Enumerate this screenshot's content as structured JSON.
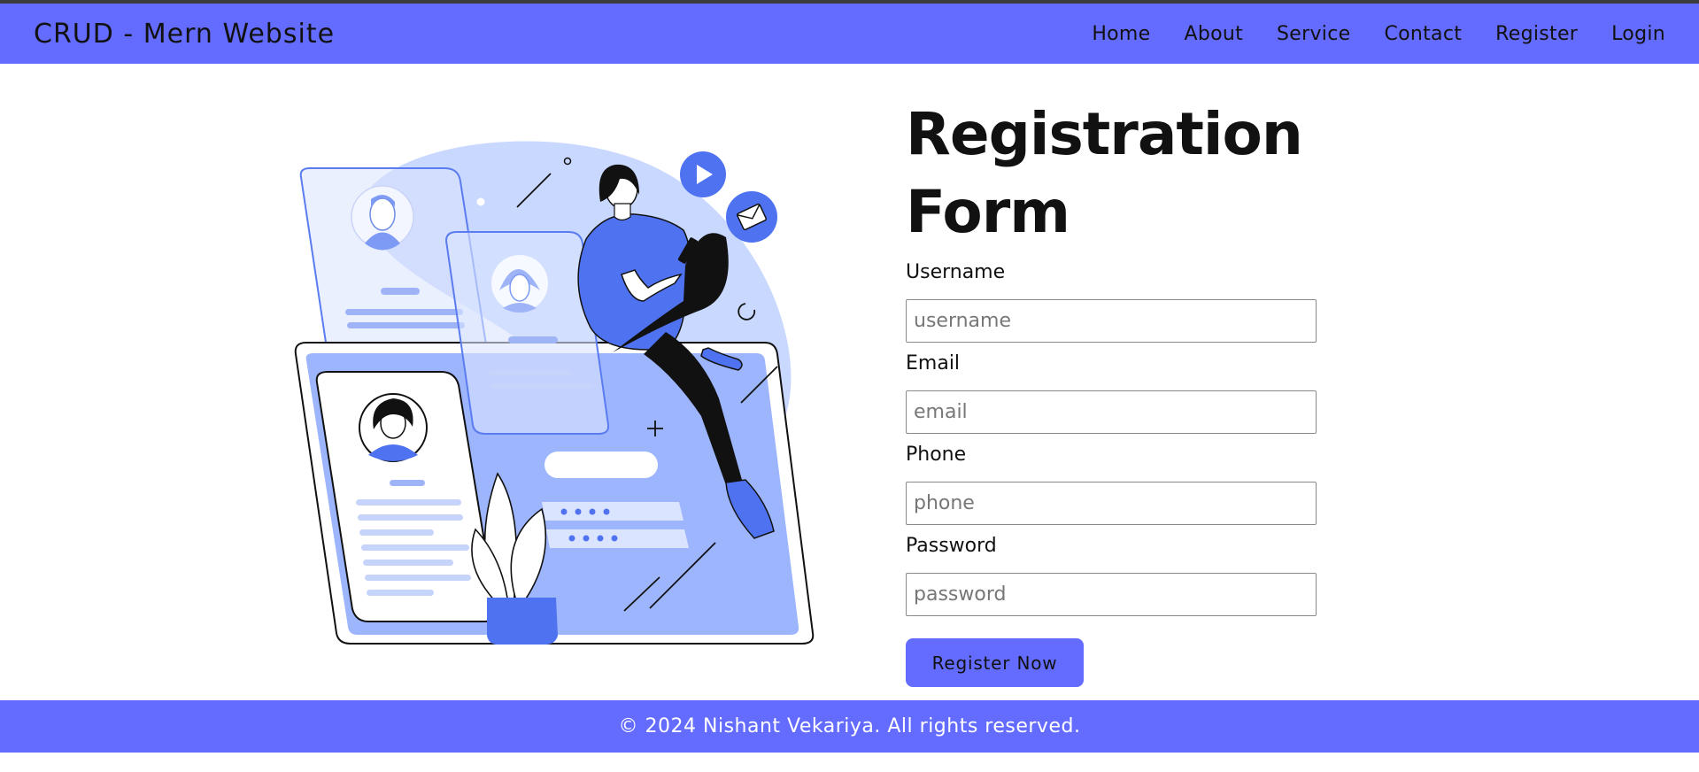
{
  "navbar": {
    "brand": "CRUD - Mern Website",
    "links": [
      "Home",
      "About",
      "Service",
      "Contact",
      "Register",
      "Login"
    ]
  },
  "form": {
    "title": "Registration Form",
    "fields": [
      {
        "label": "Username",
        "placeholder": "username"
      },
      {
        "label": "Email",
        "placeholder": "email"
      },
      {
        "label": "Phone",
        "placeholder": "phone"
      },
      {
        "label": "Password",
        "placeholder": "password"
      }
    ],
    "submit_label": "Register Now"
  },
  "footer": {
    "text": "© 2024 Nishant Vekariya. All rights reserved."
  },
  "colors": {
    "accent": "#646cff",
    "illustration_blue": "#4f73f0",
    "illustration_light": "#c9d8ff"
  },
  "icons": [
    "play-icon",
    "mail-icon",
    "avatar-icon",
    "plant-icon"
  ]
}
